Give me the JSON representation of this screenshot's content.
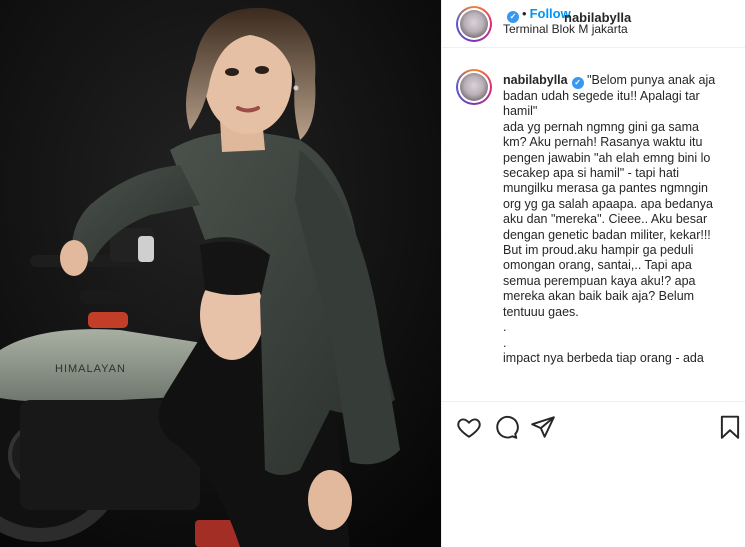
{
  "post": {
    "username": "nabilabylla",
    "separator": "•",
    "follow_label": "Follow",
    "location": "Terminal Blok M jakarta",
    "verified_glyph": "✓"
  },
  "caption": {
    "username": "nabilabylla",
    "text": " \"Belom punya anak aja\nbadan udah segede itu!! Apalagi tar\nhamil\"\nada yg pernah ngmng gini ga sama\nkm? Aku pernah! Rasanya waktu itu\npengen jawabin \"ah elah emng bini lo\nsecakep apa si hamil\" - tapi hati\nmungilku merasa ga pantes ngmngin\norg yg ga salah apaapa. apa bedanya\naku dan \"mereka\". Cieee.. Aku besar\ndengan genetic badan militer, kekar!!!\nBut im proud.aku hampir ga peduli\nomongan orang, santai,.. Tapi apa\nsemua perempuan kaya aku!? apa\nmereka akan baik baik aja? Belum\ntentuuu gaes.\n.\n.\nimpact nya berbeda tiap orang - ada"
  },
  "photo": {
    "bike_brand_text": "HIMALAYAN"
  },
  "icons": {
    "like": "heart-icon",
    "comment": "comment-icon",
    "share": "share-icon",
    "save": "bookmark-icon",
    "verified": "verified-badge-icon"
  },
  "colors": {
    "accent": "#0095f6",
    "verified": "#3897f0",
    "text": "#262626",
    "border": "#efefef"
  }
}
